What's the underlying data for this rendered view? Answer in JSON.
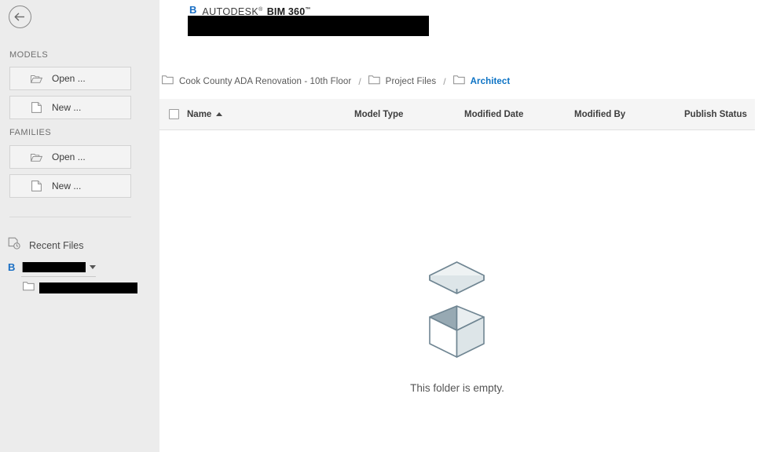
{
  "sidebar": {
    "back_button": {
      "icon": "arrow-left-circle-icon",
      "label": "Back"
    },
    "sections": [
      {
        "label": "MODELS",
        "buttons": [
          {
            "label": "Open ...",
            "icon": "open-folder-icon"
          },
          {
            "label": "New ...",
            "icon": "new-document-icon"
          }
        ]
      },
      {
        "label": "FAMILIES",
        "buttons": [
          {
            "label": "Open ...",
            "icon": "open-folder-icon"
          },
          {
            "label": "New ...",
            "icon": "new-document-icon"
          }
        ]
      }
    ],
    "recent_files": {
      "label": "Recent Files",
      "icon": "recent-document-clock-icon",
      "project": {
        "badge": "B",
        "name": "",
        "redacted": true,
        "dropdown_icon": "chevron-down-icon"
      },
      "folder": {
        "icon": "folder-icon",
        "name": "",
        "redacted": true
      }
    }
  },
  "header": {
    "brand_badge": "B",
    "brand_autodesk": "AUTODESK",
    "brand_autodesk_mark": "®",
    "brand_product": "BIM 360",
    "brand_product_mark": "™",
    "title_redacted": true,
    "title": ""
  },
  "breadcrumb": {
    "separator": "/",
    "items": [
      {
        "label": "Cook County ADA Renovation - 10th Floor",
        "icon": "folder-icon",
        "active": false
      },
      {
        "label": "Project Files",
        "icon": "folder-icon",
        "active": false
      },
      {
        "label": "Architect",
        "icon": "folder-icon",
        "active": true
      }
    ]
  },
  "table": {
    "select_all_checkbox": {
      "checked": false
    },
    "columns": [
      {
        "key": "name",
        "label": "Name",
        "sorted": "asc",
        "sort_icon": "caret-up-icon"
      },
      {
        "key": "model_type",
        "label": "Model Type"
      },
      {
        "key": "modified_date",
        "label": "Modified Date"
      },
      {
        "key": "modified_by",
        "label": "Modified By"
      },
      {
        "key": "publish_status",
        "label": "Publish Status"
      }
    ],
    "rows": []
  },
  "empty_state": {
    "illustration": "open-empty-box-icon",
    "message": "This folder is empty."
  },
  "colors": {
    "accent_blue": "#0b72c4",
    "brand_blue": "#1a6fc4",
    "sidebar_bg": "#ececec",
    "table_head_bg": "#f5f5f5",
    "illustration_stroke": "#6f8592",
    "text_primary": "#3d3d3d",
    "text_secondary": "#6e6e6e"
  }
}
